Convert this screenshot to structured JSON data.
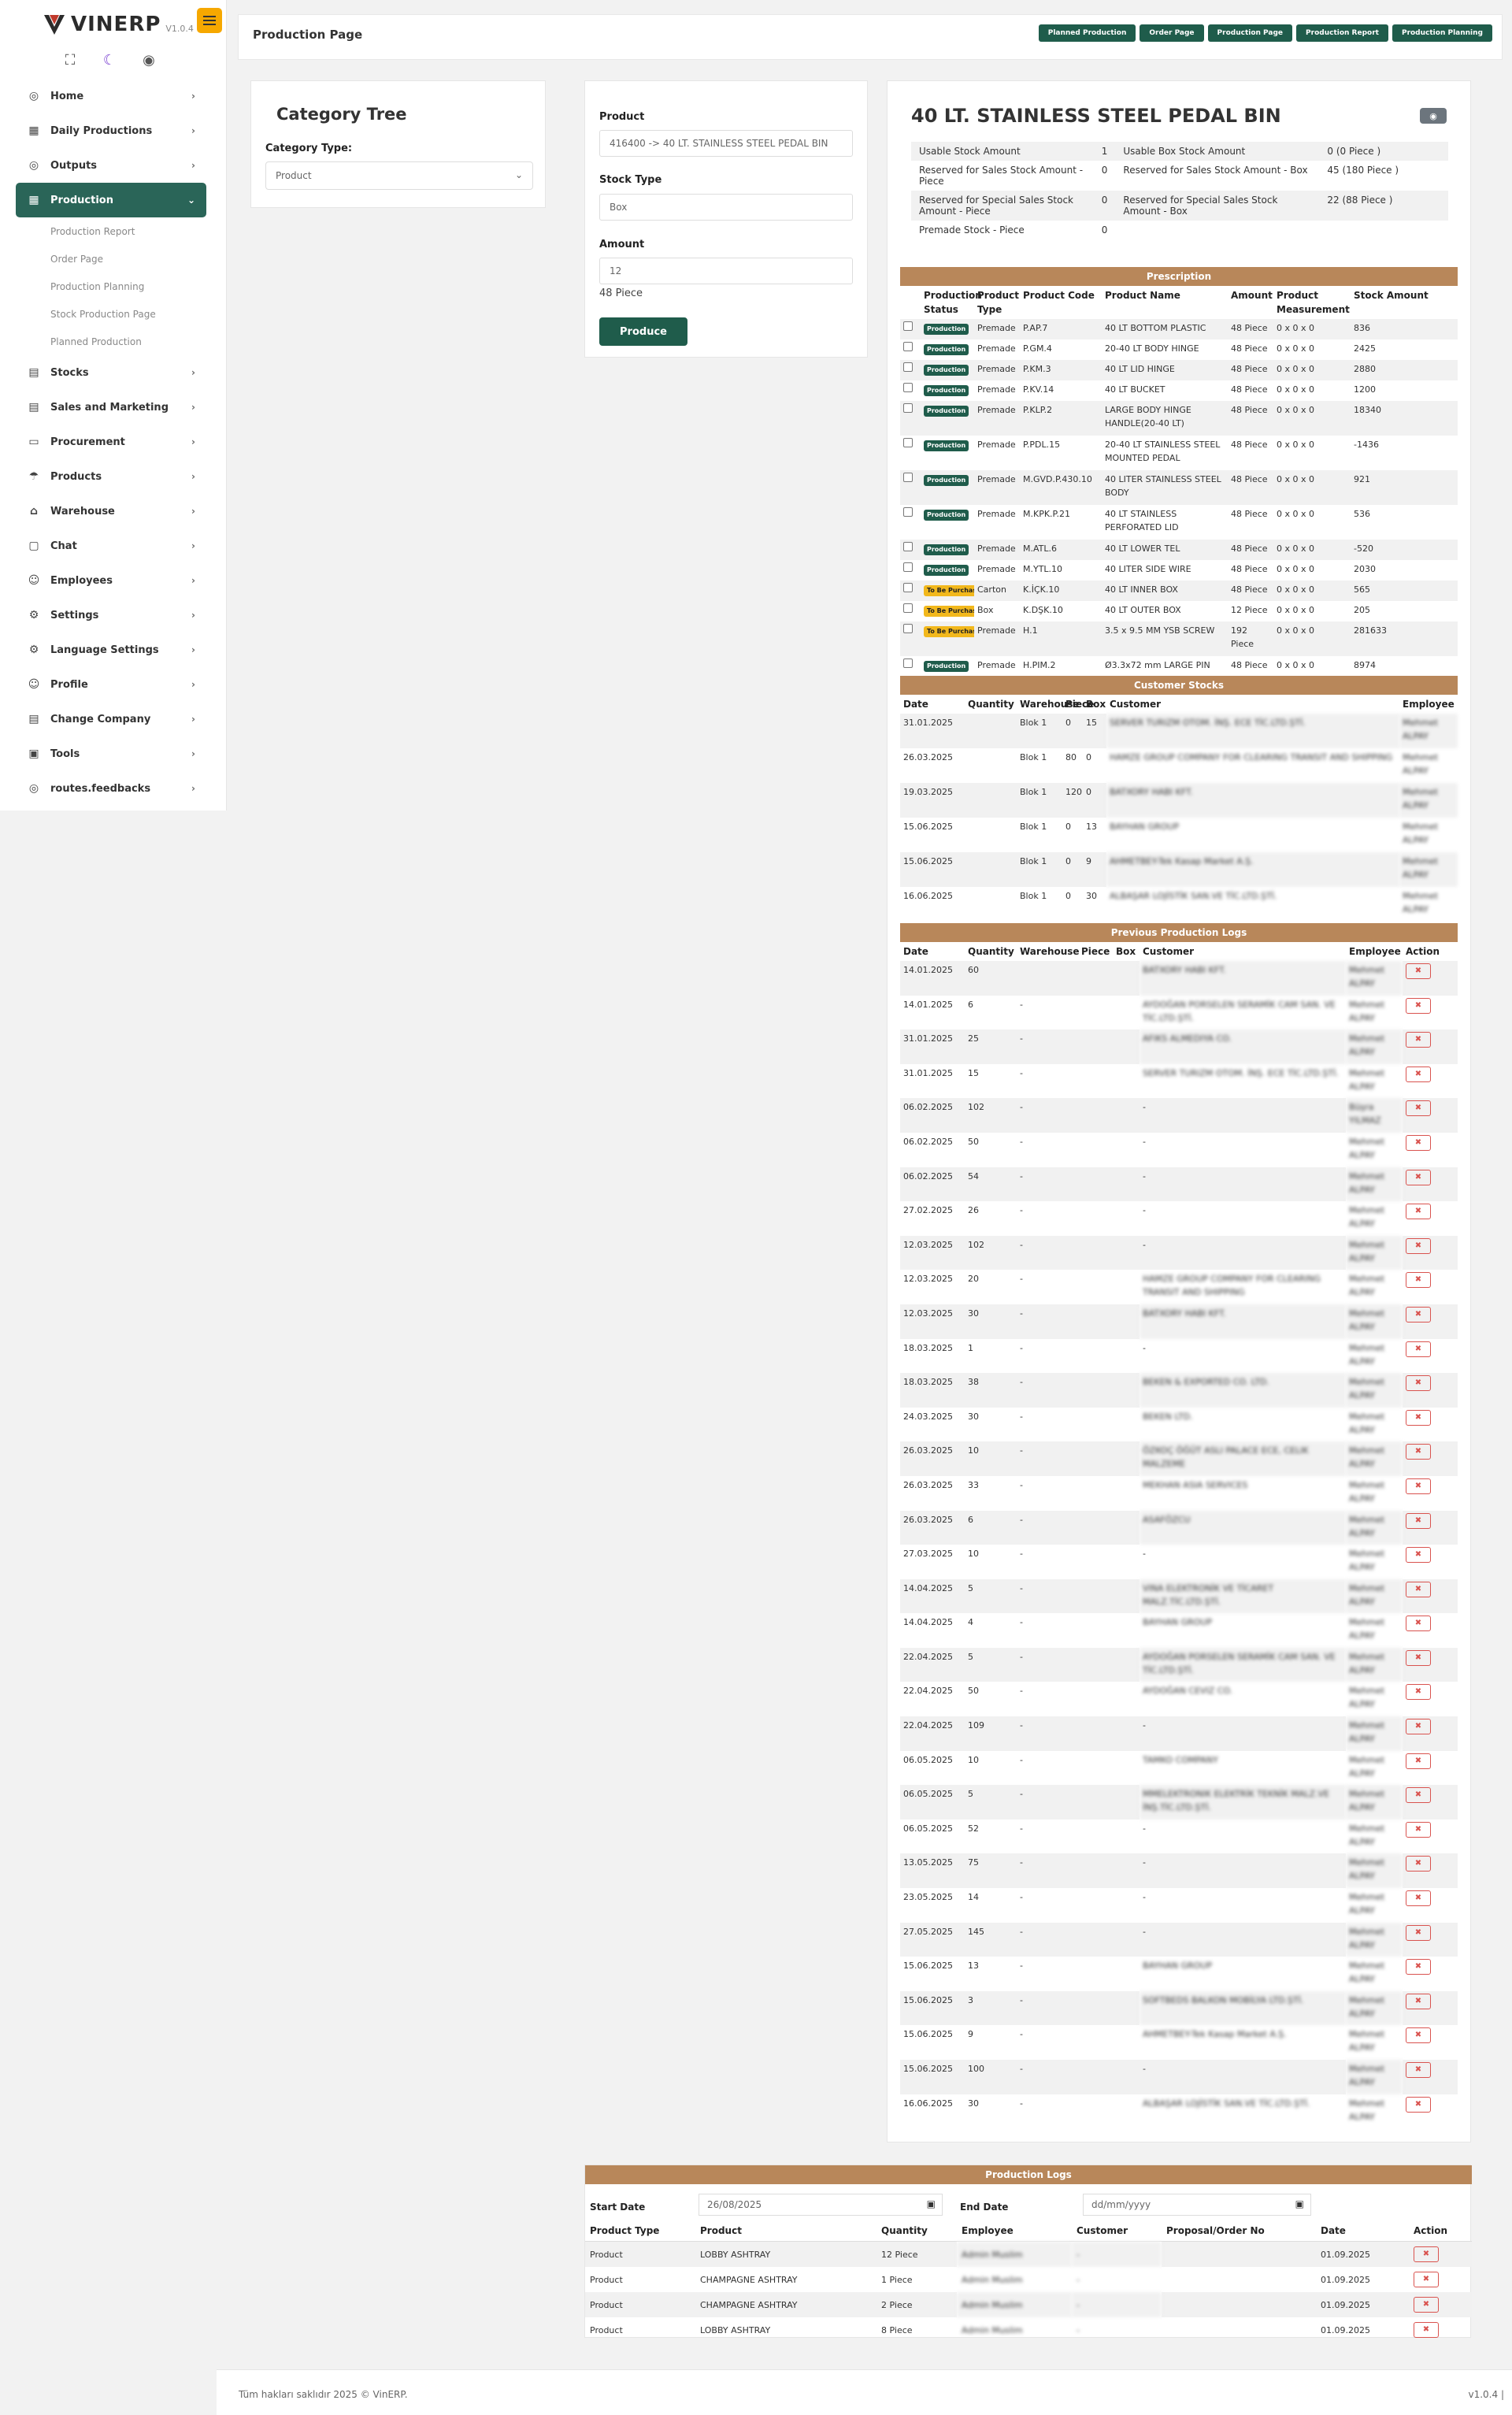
{
  "app": {
    "name": "VINERP",
    "version": "V1.0.4"
  },
  "sidebar": {
    "items": [
      {
        "label": "Home",
        "icon": "gauge-icon",
        "glyph": "◎"
      },
      {
        "label": "Daily Productions",
        "icon": "calendar-icon",
        "glyph": "▦"
      },
      {
        "label": "Outputs",
        "icon": "gauge-icon",
        "glyph": "◎"
      },
      {
        "label": "Production",
        "icon": "calendar-icon",
        "glyph": "▦",
        "active": true,
        "sub": [
          "Production Report",
          "Order Page",
          "Production Planning",
          "Stock Production Page",
          "Planned Production"
        ]
      },
      {
        "label": "Stocks",
        "icon": "table-icon",
        "glyph": "▤"
      },
      {
        "label": "Sales and Marketing",
        "icon": "table-icon",
        "glyph": "▤"
      },
      {
        "label": "Procurement",
        "icon": "card-icon",
        "glyph": "▭"
      },
      {
        "label": "Products",
        "icon": "umbrella-icon",
        "glyph": "☂"
      },
      {
        "label": "Warehouse",
        "icon": "home-icon",
        "glyph": "⌂"
      },
      {
        "label": "Chat",
        "icon": "chat-icon",
        "glyph": "▢"
      },
      {
        "label": "Employees",
        "icon": "users-icon",
        "glyph": "☺"
      },
      {
        "label": "Settings",
        "icon": "gear-icon",
        "glyph": "⚙"
      },
      {
        "label": "Language Settings",
        "icon": "gear-icon",
        "glyph": "⚙"
      },
      {
        "label": "Profile",
        "icon": "user-icon",
        "glyph": "☺"
      },
      {
        "label": "Change Company",
        "icon": "document-icon",
        "glyph": "▤"
      },
      {
        "label": "Tools",
        "icon": "image-icon",
        "glyph": "▣"
      },
      {
        "label": "routes.feedbacks",
        "icon": "gauge-icon",
        "glyph": "◎"
      }
    ]
  },
  "header": {
    "title": "Production Page",
    "nav": [
      "Planned Production",
      "Order Page",
      "Production Page",
      "Production Report",
      "Production Planning"
    ]
  },
  "category": {
    "title": "Category Tree",
    "type_label": "Category Type:",
    "type_value": "Product"
  },
  "form": {
    "product_label": "Product",
    "product_value": "416400 -> 40 LT. STAINLESS STEEL PEDAL BIN",
    "stock_type_label": "Stock Type",
    "stock_type_placeholder": "Box",
    "amount_label": "Amount",
    "amount_value": "12",
    "amount_note": "48 Piece",
    "produce_button": "Produce"
  },
  "detail": {
    "title": "40 LT. STAINLESS STEEL PEDAL BIN",
    "eye_icon": "eye-icon",
    "info": [
      [
        "Usable Stock Amount",
        "1",
        "Usable Box Stock Amount",
        "0 (0 Piece )"
      ],
      [
        "Reserved for Sales Stock Amount - Piece",
        "0",
        "Reserved for Sales Stock Amount - Box",
        "45 (180 Piece )"
      ],
      [
        "Reserved for Special Sales Stock Amount - Piece",
        "0",
        "Reserved for Special Sales Stock Amount - Box",
        "22 (88 Piece )"
      ],
      [
        "Premade Stock - Piece",
        "0",
        "",
        ""
      ]
    ]
  },
  "prescription": {
    "title": "Prescription",
    "headers": [
      "",
      "Production Status",
      "Product Type",
      "Product Code",
      "Product Name",
      "Amount",
      "Product Measurement",
      "Stock Amount"
    ],
    "rows": [
      [
        "Production",
        "Premade",
        "P.AP.7",
        "40 LT BOTTOM PLASTIC",
        "48 Piece",
        "0 x 0 x 0",
        "836"
      ],
      [
        "Production",
        "Premade",
        "P.GM.4",
        "20-40 LT BODY HINGE",
        "48 Piece",
        "0 x 0 x 0",
        "2425"
      ],
      [
        "Production",
        "Premade",
        "P.KM.3",
        "40 LT LID HINGE",
        "48 Piece",
        "0 x 0 x 0",
        "2880"
      ],
      [
        "Production",
        "Premade",
        "P.KV.14",
        "40 LT BUCKET",
        "48 Piece",
        "0 x 0 x 0",
        "1200"
      ],
      [
        "Production",
        "Premade",
        "P.KLP.2",
        "LARGE BODY HINGE HANDLE(20-40 LT)",
        "48 Piece",
        "0 x 0 x 0",
        "18340"
      ],
      [
        "Production",
        "Premade",
        "P.PDL.15",
        "20-40 LT STAINLESS STEEL MOUNTED PEDAL",
        "48 Piece",
        "0 x 0 x 0",
        "-1436"
      ],
      [
        "Production",
        "Premade",
        "M.GVD.P.430.10",
        "40 LITER STAINLESS STEEL BODY",
        "48 Piece",
        "0 x 0 x 0",
        "921"
      ],
      [
        "Production",
        "Premade",
        "M.KPK.P.21",
        "40 LT STAINLESS PERFORATED LID",
        "48 Piece",
        "0 x 0 x 0",
        "536"
      ],
      [
        "Production",
        "Premade",
        "M.ATL.6",
        "40 LT LOWER TEL",
        "48 Piece",
        "0 x 0 x 0",
        "-520"
      ],
      [
        "Production",
        "Premade",
        "M.YTL.10",
        "40 LITER SIDE WIRE",
        "48 Piece",
        "0 x 0 x 0",
        "2030"
      ],
      [
        "To Be Purchased",
        "Carton",
        "K.İÇK.10",
        "40 LT INNER BOX",
        "48 Piece",
        "0 x 0 x 0",
        "565"
      ],
      [
        "To Be Purchased",
        "Box",
        "K.DŞK.10",
        "40 LT OUTER BOX",
        "12 Piece",
        "0 x 0 x 0",
        "205"
      ],
      [
        "To Be Purchased",
        "Premade",
        "H.1",
        "3.5 x 9.5 MM YSB SCREW",
        "192 Piece",
        "0 x 0 x 0",
        "281633"
      ],
      [
        "Production",
        "Premade",
        "H.PIM.2",
        "Ø3.3x72 mm LARGE PIN",
        "48 Piece",
        "0 x 0 x 0",
        "8974"
      ]
    ]
  },
  "customer_stocks": {
    "title": "Customer Stocks",
    "headers": [
      "Date",
      "Quantity",
      "Warehouse",
      "Piece",
      "Box",
      "Customer",
      "Employee"
    ],
    "rows": [
      [
        "31.01.2025",
        "",
        "Blok 1",
        "0",
        "15",
        "SERVER TURIZM OTOM. İNŞ. ECE TİC.LTD.ŞTİ.",
        "Mehmet ALPAY"
      ],
      [
        "26.03.2025",
        "",
        "Blok 1",
        "80",
        "0",
        "HAMZE GROUP COMPANY FOR CLEARING TRANSIT AND SHIPPING",
        "Mehmet ALPAY"
      ],
      [
        "19.03.2025",
        "",
        "Blok 1",
        "120",
        "0",
        "BATXORY HABI KFT.",
        "Mehmet ALPAY"
      ],
      [
        "15.06.2025",
        "",
        "Blok 1",
        "0",
        "13",
        "BAYHAN GROUP",
        "Mehmet ALPAY"
      ],
      [
        "15.06.2025",
        "",
        "Blok 1",
        "0",
        "9",
        "AHMETBEY-Tek Kasap Market A.Ş.",
        "Mehmet ALPAY"
      ],
      [
        "16.06.2025",
        "",
        "Blok 1",
        "0",
        "30",
        "ALBAŞAR LOJİSTİK SAN.VE TİC.LTD.ŞTİ.",
        "Mehmet ALPAY"
      ]
    ]
  },
  "previous_logs": {
    "title": "Previous Production Logs",
    "headers": [
      "Date",
      "Quantity",
      "Warehouse",
      "Piece",
      "Box",
      "Customer",
      "Employee",
      "Action"
    ],
    "rows": [
      [
        "14.01.2025",
        "60",
        "",
        "",
        "",
        "BATXORY HABI KFT.",
        "Mehmet ALPAY"
      ],
      [
        "14.01.2025",
        "6",
        "-",
        "",
        "",
        "AYDOĞAN PORSELEN SERAMİK CAM SAN. VE TİC.LTD.ŞTİ.",
        "Mehmet ALPAY"
      ],
      [
        "31.01.2025",
        "25",
        "-",
        "",
        "",
        "AFIKS ALMEDIYA CO.",
        "Mehmet ALPAY"
      ],
      [
        "31.01.2025",
        "15",
        "-",
        "",
        "",
        "SERVER TURIZM OTOM. İNŞ. ECE TİC.LTD.ŞTİ.",
        "Mehmet ALPAY"
      ],
      [
        "06.02.2025",
        "102",
        "-",
        "",
        "",
        "-",
        "Büşra YILMAZ"
      ],
      [
        "06.02.2025",
        "50",
        "-",
        "",
        "",
        "-",
        "Mehmet ALPAY"
      ],
      [
        "06.02.2025",
        "54",
        "-",
        "",
        "",
        "-",
        "Mehmet ALPAY"
      ],
      [
        "27.02.2025",
        "26",
        "-",
        "",
        "",
        "-",
        "Mehmet ALPAY"
      ],
      [
        "12.03.2025",
        "102",
        "-",
        "",
        "",
        "-",
        "Mehmet ALPAY"
      ],
      [
        "12.03.2025",
        "20",
        "-",
        "",
        "",
        "HAMZE GROUP COMPANY FOR CLEARING TRANSIT AND SHIPPING",
        "Mehmet ALPAY"
      ],
      [
        "12.03.2025",
        "30",
        "-",
        "",
        "",
        "BATXORY HABI KFT.",
        "Mehmet ALPAY"
      ],
      [
        "18.03.2025",
        "1",
        "-",
        "",
        "",
        "-",
        "Mehmet ALPAY"
      ],
      [
        "18.03.2025",
        "38",
        "-",
        "",
        "",
        "BEKEN & EXPORTED CO. LTD.",
        "Mehmet ALPAY"
      ],
      [
        "24.03.2025",
        "30",
        "-",
        "",
        "",
        "BEKEN LTD.",
        "Mehmet ALPAY"
      ],
      [
        "26.03.2025",
        "10",
        "-",
        "",
        "",
        "ÖZKOÇ ÖĞÜT ASLI PALACE ECE, CELIK MALZEME",
        "Mehmet ALPAY"
      ],
      [
        "26.03.2025",
        "33",
        "-",
        "",
        "",
        "MEKHAN ASIA SERVICES",
        "Mehmet ALPAY"
      ],
      [
        "26.03.2025",
        "6",
        "-",
        "",
        "",
        "ASAFÖZCU",
        "Mehmet ALPAY"
      ],
      [
        "27.03.2025",
        "10",
        "-",
        "",
        "",
        "-",
        "Mehmet ALPAY"
      ],
      [
        "14.04.2025",
        "5",
        "-",
        "",
        "",
        "VINA ELEKTRONİK VE TİCARET MALZ.TİC.LTD.ŞTİ.",
        "Mehmet ALPAY"
      ],
      [
        "14.04.2025",
        "4",
        "-",
        "",
        "",
        "BAYHAN GROUP",
        "Mehmet ALPAY"
      ],
      [
        "22.04.2025",
        "5",
        "-",
        "",
        "",
        "AYDOĞAN PORSELEN SERAMİK CAM SAN. VE TİC.LTD.ŞTİ.",
        "Mehmet ALPAY"
      ],
      [
        "22.04.2025",
        "50",
        "-",
        "",
        "",
        "AYDOĞAN CEVIZ CO.",
        "Mehmet ALPAY"
      ],
      [
        "22.04.2025",
        "109",
        "-",
        "",
        "",
        "-",
        "Mehmet ALPAY"
      ],
      [
        "06.05.2025",
        "10",
        "-",
        "",
        "",
        "TAMKO COMPANY",
        "Mehmet ALPAY"
      ],
      [
        "06.05.2025",
        "5",
        "-",
        "",
        "",
        "MMELEKTRONIK ELEKTRİK TEKNİK MALZ.VE İNŞ.TİC.LTD.ŞTİ.",
        "Mehmet ALPAY"
      ],
      [
        "06.05.2025",
        "52",
        "-",
        "",
        "",
        "-",
        "Mehmet ALPAY"
      ],
      [
        "13.05.2025",
        "75",
        "-",
        "",
        "",
        "-",
        "Mehmet ALPAY"
      ],
      [
        "23.05.2025",
        "14",
        "-",
        "",
        "",
        "-",
        "Mehmet ALPAY"
      ],
      [
        "27.05.2025",
        "145",
        "-",
        "",
        "",
        "-",
        "Mehmet ALPAY"
      ],
      [
        "15.06.2025",
        "13",
        "-",
        "",
        "",
        "BAYHAN GROUP",
        "Mehmet ALPAY"
      ],
      [
        "15.06.2025",
        "3",
        "-",
        "",
        "",
        "SOFTBEDS BALKON MOBİLYA LTD.ŞTİ.",
        "Mehmet ALPAY"
      ],
      [
        "15.06.2025",
        "9",
        "-",
        "",
        "",
        "AHMETBEY-Tek Kasap Market A.Ş.",
        "Mehmet ALPAY"
      ],
      [
        "15.06.2025",
        "100",
        "-",
        "",
        "",
        "-",
        "Mehmet ALPAY"
      ],
      [
        "16.06.2025",
        "30",
        "-",
        "",
        "",
        "ALBAŞAR LOJİSTİK SAN.VE TİC.LTD.ŞTİ.",
        "Mehmet ALPAY"
      ]
    ]
  },
  "production_logs": {
    "title": "Production Logs",
    "start_label": "Start Date",
    "start_value": "26/08/2025",
    "end_label": "End Date",
    "end_placeholder": "dd/mm/yyyy",
    "headers": [
      "Product Type",
      "Product",
      "Quantity",
      "Employee",
      "Customer",
      "Proposal/Order No",
      "Date",
      "Action"
    ],
    "rows": [
      [
        "Product",
        "LOBBY ASHTRAY",
        "12 Piece",
        "Admin Muslim",
        "-",
        "",
        "01.09.2025"
      ],
      [
        "Product",
        "CHAMPAGNE ASHTRAY",
        "1 Piece",
        "Admin Muslim",
        "-",
        "",
        "01.09.2025"
      ],
      [
        "Product",
        "CHAMPAGNE ASHTRAY",
        "2 Piece",
        "Admin Muslim",
        "-",
        "",
        "01.09.2025"
      ],
      [
        "Product",
        "LOBBY ASHTRAY",
        "8 Piece",
        "Admin Muslim",
        "-",
        "",
        "01.09.2025"
      ]
    ]
  },
  "delete_icon": "✖",
  "footer": {
    "text": "Tüm hakları saklıdır 2025 © VinERP.",
    "version": "v1.0.4 |"
  },
  "colors": {
    "primary": "#1f5c4b",
    "section": "#b8875a",
    "warning": "#f2b81c",
    "accent": "#f6a800"
  }
}
